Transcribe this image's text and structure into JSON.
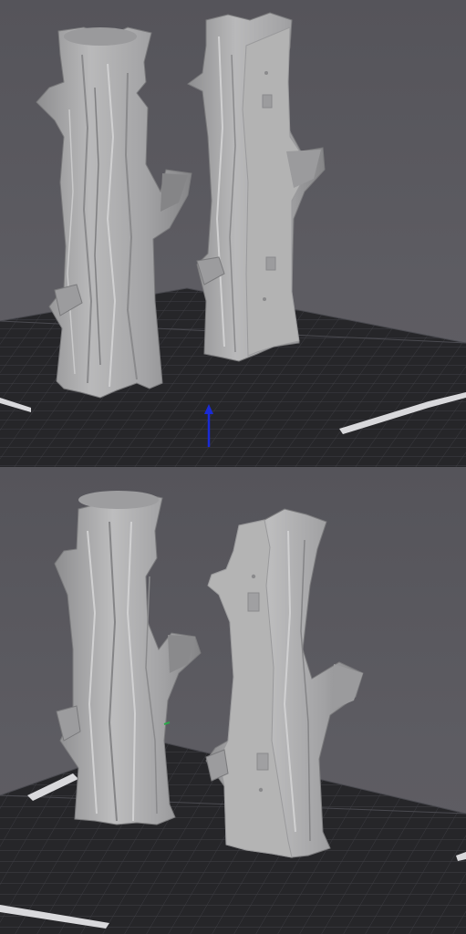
{
  "views": [
    {
      "id": "view-top",
      "bed_label_left": "",
      "bed_label_right": "",
      "models": [
        "tree-trunk-full",
        "tree-trunk-cut"
      ],
      "axis_color": "#1a2bd6"
    },
    {
      "id": "view-bottom",
      "bed_label_left": "",
      "bed_label_right": "",
      "models": [
        "tree-trunk-full",
        "tree-trunk-cut"
      ],
      "axis_color": "#2ca84a"
    }
  ],
  "colors": {
    "background": "#5b5a60",
    "bed": "#262629",
    "grid_line": "#3e3e44",
    "model": "#a9a9a9",
    "model_shadow": "#7d7d7f",
    "cut_face": "#b3b3b3"
  }
}
